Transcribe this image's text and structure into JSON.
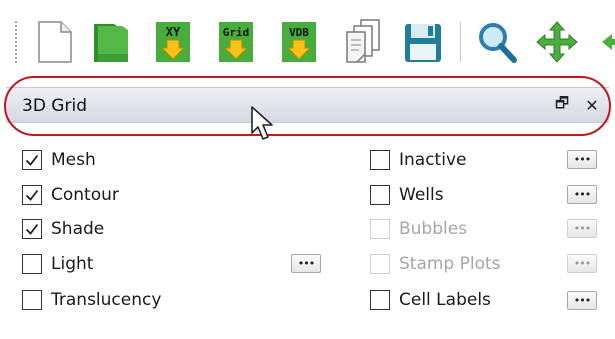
{
  "toolbar": {
    "buttons": [
      {
        "name": "new-document-icon",
        "text": ""
      },
      {
        "name": "open-folder-icon",
        "text": ""
      },
      {
        "name": "import-xy-icon",
        "text": "XY"
      },
      {
        "name": "import-grid-icon",
        "text": "Grid"
      },
      {
        "name": "import-vdb-icon",
        "text": "VDB"
      },
      {
        "name": "copy-pages-icon",
        "text": ""
      },
      {
        "name": "save-floppy-icon",
        "text": ""
      },
      {
        "name": "zoom-magnifier-icon",
        "text": ""
      },
      {
        "name": "pan-move-icon",
        "text": ""
      }
    ]
  },
  "panel": {
    "title": "3D Grid",
    "float_glyph": "🗗",
    "close_glyph": "✕"
  },
  "options_left": [
    {
      "label": "Mesh",
      "checked": true,
      "enabled": true
    },
    {
      "label": "Contour",
      "checked": true,
      "enabled": true
    },
    {
      "label": "Shade",
      "checked": true,
      "enabled": true
    },
    {
      "label": "Light",
      "checked": false,
      "enabled": true,
      "has_more": true
    },
    {
      "label": "Translucency",
      "checked": false,
      "enabled": true
    }
  ],
  "options_right": [
    {
      "label": "Inactive",
      "checked": false,
      "enabled": true,
      "has_more": true
    },
    {
      "label": "Wells",
      "checked": false,
      "enabled": true,
      "has_more": true
    },
    {
      "label": "Bubbles",
      "checked": false,
      "enabled": false,
      "has_more": true
    },
    {
      "label": "Stamp Plots",
      "checked": false,
      "enabled": false,
      "has_more": true
    },
    {
      "label": "Cell Labels",
      "checked": false,
      "enabled": true,
      "has_more": true
    }
  ],
  "more_glyph": "•••",
  "colors": {
    "highlight": "#c0181f",
    "green": "#3fa535",
    "arrow": "#f0b400",
    "disabled_text": "#a6a6a6"
  }
}
